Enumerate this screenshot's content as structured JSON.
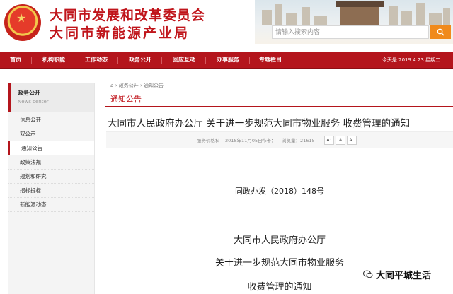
{
  "header": {
    "org_name_1": "大同市发展和改革委员会",
    "org_name_2": "大同市新能源产业局",
    "search_placeholder": "请输入搜索内容"
  },
  "nav": {
    "items": [
      "首页",
      "机构职能",
      "工作动态",
      "政务公开",
      "回应互动",
      "办事服务",
      "专题栏目"
    ],
    "date_label": "今天是  2019.4.23  星期二"
  },
  "sidebar": {
    "heading": "政务公开",
    "heading_en": "News center",
    "items": [
      "信息公开",
      "双公示",
      "通知公告",
      "政策法规",
      "规划和研究",
      "招标投标",
      "新能源动态"
    ],
    "active_index": 2
  },
  "breadcrumb": [
    "政务公开",
    "通知公告"
  ],
  "section_title": "通知公告",
  "article": {
    "title": "大同市人民政府办公厅 关于进一步规范大同市物业服务 收费管理的通知",
    "source": "服务价格科",
    "date": "2018年11月05日",
    "author_label": "作者：",
    "views": "浏览量：21615",
    "font_buttons": [
      "A⁺",
      "A",
      "A⁻"
    ],
    "doc_number": "同政办发（2018）148号",
    "body_lines": [
      "大同市人民政府办公厅",
      "关于进一步规范大同市物业服务",
      "收费管理的通知"
    ]
  },
  "watermark": "大同平城生活",
  "colors": {
    "brand_red": "#b4151c",
    "title_red": "#c0151b",
    "search_orange": "#f08a1c"
  }
}
